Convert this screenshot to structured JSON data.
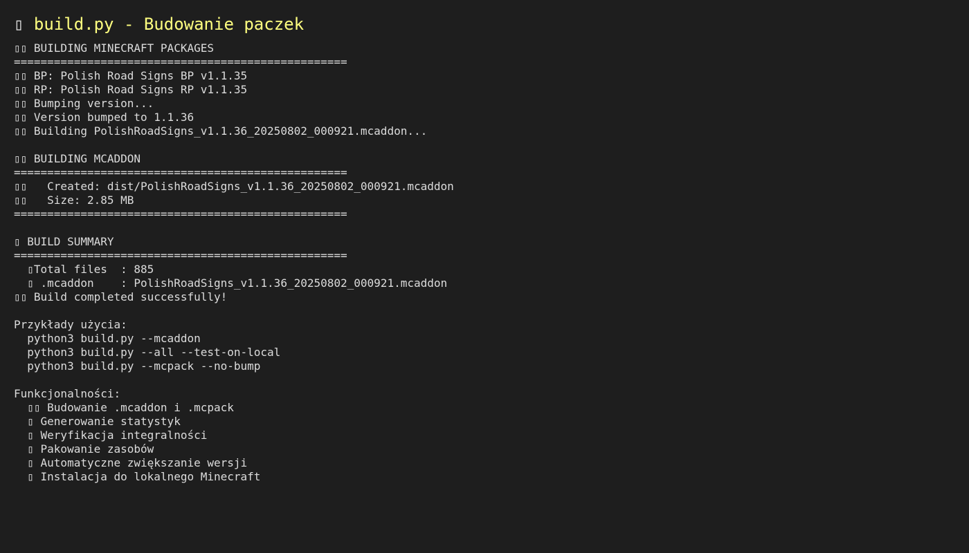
{
  "window": {
    "title_icon": "▯",
    "title_text": "build.py - Budowanie paczek"
  },
  "output_lines": [
    "▯▯ BUILDING MINECRAFT PACKAGES",
    "==================================================",
    "▯▯ BP: Polish Road Signs BP v1.1.35",
    "▯▯ RP: Polish Road Signs RP v1.1.35",
    "▯▯ Bumping version...",
    "▯▯ Version bumped to 1.1.36",
    "▯▯ Building PolishRoadSigns_v1.1.36_20250802_000921.mcaddon...",
    "",
    "▯▯ BUILDING MCADDON",
    "==================================================",
    "▯▯   Created: dist/PolishRoadSigns_v1.1.36_20250802_000921.mcaddon",
    "▯▯   Size: 2.85 MB",
    "==================================================",
    "",
    "▯ BUILD SUMMARY",
    "==================================================",
    "  ▯Total files  : 885",
    "  ▯ .mcaddon    : PolishRoadSigns_v1.1.36_20250802_000921.mcaddon",
    "▯▯ Build completed successfully!",
    "",
    "Przykłady użycia:",
    "  python3 build.py --mcaddon",
    "  python3 build.py --all --test-on-local",
    "  python3 build.py --mcpack --no-bump",
    "",
    "Funkcjonalności:",
    "  ▯▯ Budowanie .mcaddon i .mcpack",
    "  ▯ Generowanie statystyk",
    "  ▯ Weryfikacja integralności",
    "  ▯ Pakowanie zasobów",
    "  ▯ Automatyczne zwiększanie wersji",
    "  ▯ Instalacja do lokalnego Minecraft"
  ],
  "colors": {
    "background": "#1e1e1e",
    "text": "#dcdcdc",
    "title": "#ffff80"
  }
}
